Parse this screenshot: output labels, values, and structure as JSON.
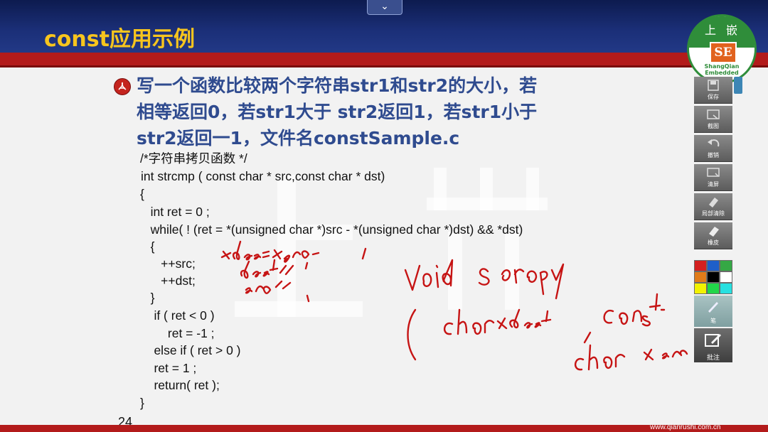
{
  "slide": {
    "title": "const应用示例",
    "heading_lines": [
      "写一个函数比较两个字符串str1和str2的大小，若",
      "相等返回0，若str1大于 str2返回1，若str1小于",
      "str2返回一1，文件名constSample.c"
    ],
    "code_lines": [
      "/*字符串拷贝函数 */",
      "int strcmp ( const char * src,const char * dst)",
      "{",
      "   int ret = 0 ;",
      "   while( ! (ret = *(unsigned char *)src - *(unsigned char *)dst) && *dst)",
      "   {",
      "      ++src;",
      "      ++dst;",
      "   }",
      "    if ( ret < 0 )",
      "        ret = -1 ;",
      "    else if ( ret > 0 )",
      "    ret = 1 ;",
      "    return( ret );",
      "}"
    ],
    "slide_number": "24",
    "footer_url": "www.qianrushi.com.cn"
  },
  "logo": {
    "top_text_left": "上",
    "top_text_right": "嵌",
    "center_text": "SE",
    "ring_text": "ShangQian Embedded"
  },
  "top_tab": {
    "icon": "chevron-down-icon",
    "label": "⌄"
  },
  "toolbar": {
    "save": "保存",
    "screenshot": "截图",
    "undo": "撤销",
    "clear": "清屏",
    "partial_erase": "局部清除",
    "eraser": "橡皮",
    "pen": "笔",
    "annotate": "批注",
    "palette_colors": [
      "#d42020",
      "#1f5fc9",
      "#35a845",
      "#e07b19",
      "#000000",
      "#ffffff",
      "#f2f200",
      "#22d64a",
      "#27e0e0"
    ]
  },
  "handwriting": {
    "description_free": true
  },
  "colors": {
    "accent_title": "#f7c51e",
    "heading_text": "#2f4b8f",
    "brand_red": "#b31b1b",
    "header_blue": "#1b2f78",
    "ink_red": "#c61414"
  }
}
